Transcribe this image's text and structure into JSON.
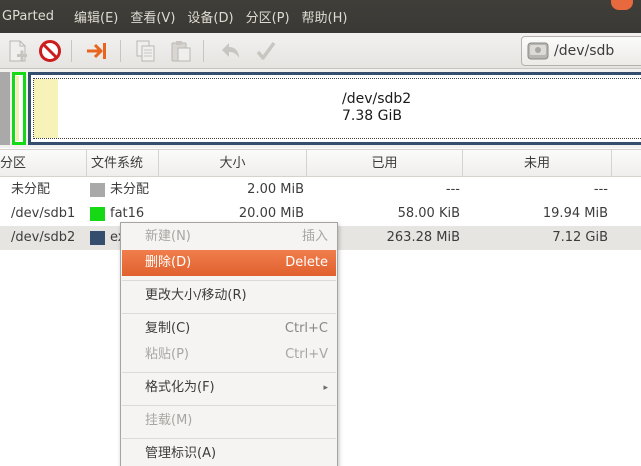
{
  "menubar": {
    "app_title": "GParted",
    "items": [
      "编辑(E)",
      "查看(V)",
      "设备(D)",
      "分区(P)",
      "帮助(H)"
    ]
  },
  "toolbar": {
    "buttons": [
      {
        "icon": "new-partition-icon",
        "enabled": false
      },
      {
        "icon": "delete-icon",
        "enabled": true
      },
      {
        "icon": "resize-move-icon",
        "enabled": true
      },
      {
        "icon": "copy-icon",
        "enabled": false
      },
      {
        "icon": "paste-icon",
        "enabled": false
      },
      {
        "icon": "undo-icon",
        "enabled": false
      },
      {
        "icon": "apply-icon",
        "enabled": false
      }
    ],
    "device": {
      "label": "/dev/sdb",
      "size": "("
    }
  },
  "graphic": {
    "selected_name": "/dev/sdb2",
    "selected_size": "7.38 GiB"
  },
  "table": {
    "headers": [
      "分区",
      "文件系统",
      "大小",
      "已用",
      "未用"
    ],
    "rows": [
      {
        "partition": "未分配",
        "filesystem": "未分配",
        "fs_color": "#a9a9a9",
        "size": "2.00 MiB",
        "used": "---",
        "unused": "---"
      },
      {
        "partition": "/dev/sdb1",
        "filesystem": "fat16",
        "fs_color": "#16d916",
        "size": "20.00 MiB",
        "used": "58.00 KiB",
        "unused": "19.94 MiB"
      },
      {
        "partition": "/dev/sdb2",
        "filesystem": "ex",
        "fs_color": "#354e6e",
        "size": "",
        "used": "263.28 MiB",
        "unused": "7.12 GiB"
      }
    ]
  },
  "context_menu": {
    "new": {
      "label": "新建(N)",
      "accel": "插入"
    },
    "delete": {
      "label": "删除(D)",
      "accel": "Delete"
    },
    "resize": {
      "label": "更改大小/移动(R)"
    },
    "copy": {
      "label": "复制(C)",
      "accel": "Ctrl+C"
    },
    "paste": {
      "label": "粘贴(P)",
      "accel": "Ctrl+V"
    },
    "format": {
      "label": "格式化为(F)"
    },
    "mount": {
      "label": "挂载(M)"
    },
    "label": {
      "label": "管理标识(A)"
    }
  },
  "colors": {
    "menubar_bg": "#3c3b37",
    "highlight": "#e9693e",
    "unallocated": "#a9a9a9",
    "fat16": "#16d916",
    "ext": "#354e6e"
  }
}
